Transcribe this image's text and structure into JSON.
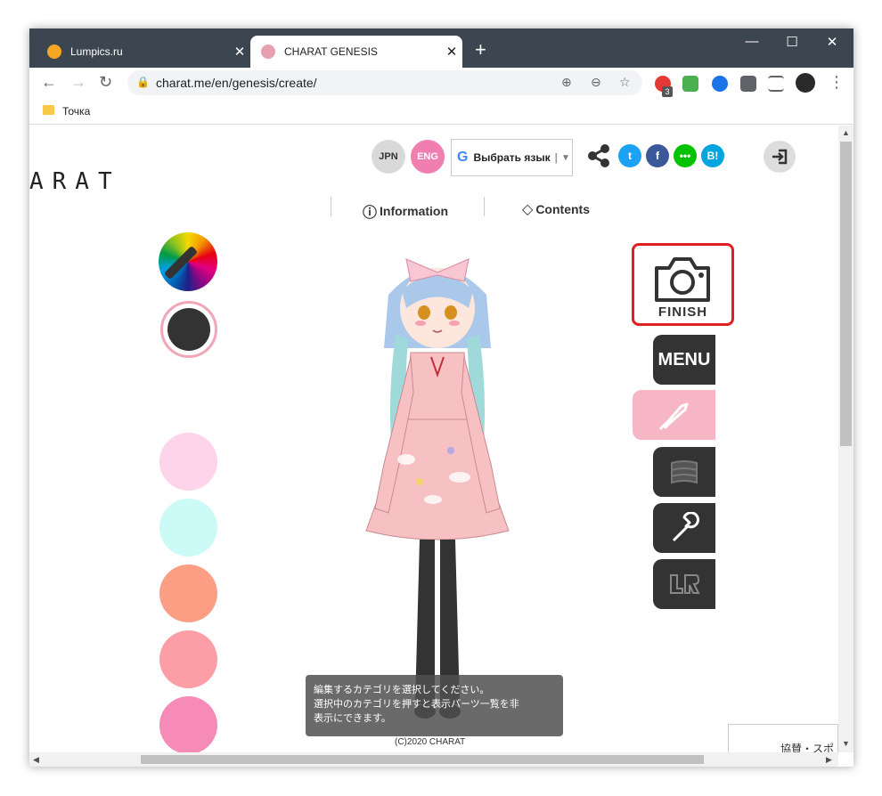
{
  "browser": {
    "tabs": [
      {
        "title": "Lumpics.ru",
        "favicon_color": "#f5a623"
      },
      {
        "title": "CHARAT GENESIS",
        "favicon_color": "#e8a0b0"
      }
    ],
    "new_tab_label": "+",
    "url": "charat.me/en/genesis/create/",
    "bookmark": "Точка",
    "extension_badge": "3"
  },
  "page": {
    "logo": "ARAT",
    "lang_jpn": "JPN",
    "lang_eng": "ENG",
    "translate_label": "Выбрать язык",
    "social_hatena": "B!",
    "nav_information": "Information",
    "nav_contents": "Contents",
    "finish_label": "FINISH",
    "menu_label": "MENU",
    "swatches": [
      "#fdd4ea",
      "#ccfbf7",
      "#fc9e83",
      "#fc9ea5",
      "#f58bb6"
    ],
    "current_color": "#333333",
    "tooltip_line1": "編集するカテゴリを選択してください。",
    "tooltip_line2": "選択中のカテゴリを押すと表示パーツ一覧を非",
    "tooltip_line3": "表示にできます。",
    "copyright": "(C)2020 CHARAT",
    "corner_text": "協賛・スポ",
    "colors": {
      "eng_pink": "#f07eb0",
      "jpn_gray": "#d9d9d9",
      "twitter": "#1da1f2",
      "facebook": "#3b5998",
      "line": "#00c300",
      "hatena": "#00a4de",
      "highlight_red": "#e02020"
    }
  }
}
